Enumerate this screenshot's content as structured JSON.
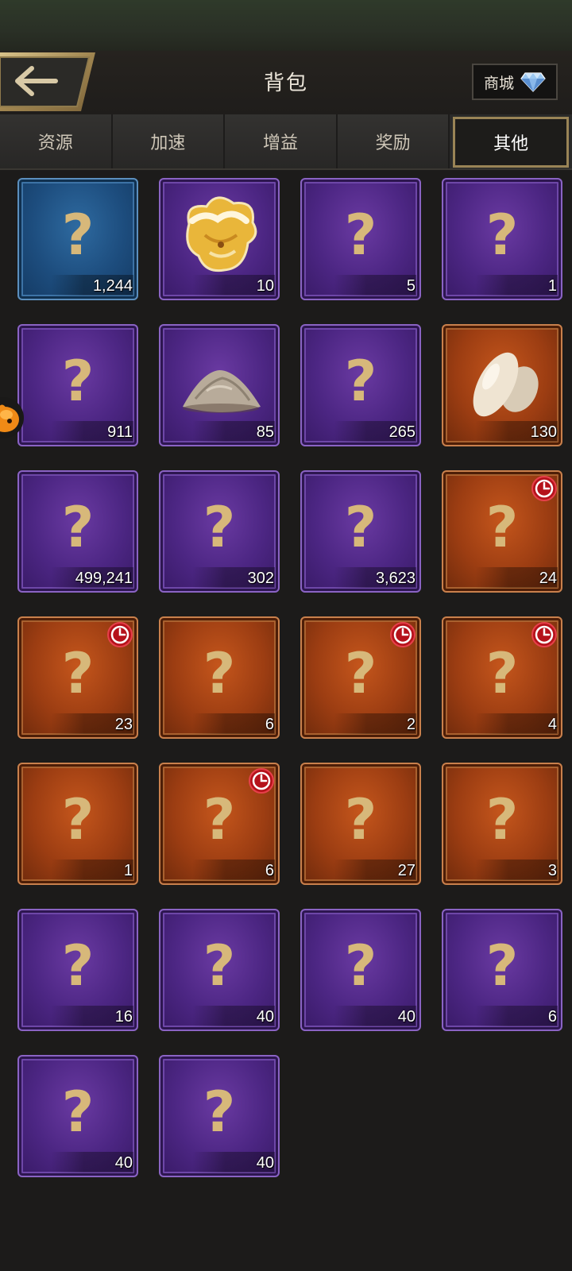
{
  "header": {
    "title": "背包",
    "shop_label": "商城"
  },
  "tabs": [
    {
      "label": "资源",
      "active": false
    },
    {
      "label": "加速",
      "active": false
    },
    {
      "label": "增益",
      "active": false
    },
    {
      "label": "奖励",
      "active": false
    },
    {
      "label": "其他",
      "active": true
    }
  ],
  "items": [
    {
      "count": "1,244",
      "rarity": "blue",
      "icon": "question-mark-icon",
      "timer": false
    },
    {
      "count": "10",
      "rarity": "purple",
      "icon": "mushroom-icon",
      "timer": false
    },
    {
      "count": "5",
      "rarity": "purple",
      "icon": "question-mark-icon",
      "timer": false
    },
    {
      "count": "1",
      "rarity": "purple",
      "icon": "question-mark-icon",
      "timer": false
    },
    {
      "count": "911",
      "rarity": "purple",
      "icon": "question-mark-icon",
      "timer": false
    },
    {
      "count": "85",
      "rarity": "purple",
      "icon": "powder-pile-icon",
      "timer": false
    },
    {
      "count": "265",
      "rarity": "purple",
      "icon": "question-mark-icon",
      "timer": false
    },
    {
      "count": "130",
      "rarity": "orange",
      "icon": "stones-icon",
      "timer": false
    },
    {
      "count": "499,241",
      "rarity": "purple",
      "icon": "question-mark-icon",
      "timer": false
    },
    {
      "count": "302",
      "rarity": "purple",
      "icon": "question-mark-icon",
      "timer": false
    },
    {
      "count": "3,623",
      "rarity": "purple",
      "icon": "question-mark-icon",
      "timer": false
    },
    {
      "count": "24",
      "rarity": "orange",
      "icon": "question-mark-icon",
      "timer": true
    },
    {
      "count": "23",
      "rarity": "orange",
      "icon": "question-mark-icon",
      "timer": true
    },
    {
      "count": "6",
      "rarity": "orange",
      "icon": "question-mark-icon",
      "timer": false
    },
    {
      "count": "2",
      "rarity": "orange",
      "icon": "question-mark-icon",
      "timer": true
    },
    {
      "count": "4",
      "rarity": "orange",
      "icon": "question-mark-icon",
      "timer": true
    },
    {
      "count": "1",
      "rarity": "orange",
      "icon": "question-mark-icon",
      "timer": false
    },
    {
      "count": "6",
      "rarity": "orange",
      "icon": "question-mark-icon",
      "timer": true
    },
    {
      "count": "27",
      "rarity": "orange",
      "icon": "question-mark-icon",
      "timer": false
    },
    {
      "count": "3",
      "rarity": "orange",
      "icon": "question-mark-icon",
      "timer": false
    },
    {
      "count": "16",
      "rarity": "purple",
      "icon": "question-mark-icon",
      "timer": false
    },
    {
      "count": "40",
      "rarity": "purple",
      "icon": "question-mark-icon",
      "timer": false
    },
    {
      "count": "40",
      "rarity": "purple",
      "icon": "question-mark-icon",
      "timer": false
    },
    {
      "count": "6",
      "rarity": "purple",
      "icon": "question-mark-icon",
      "timer": false
    },
    {
      "count": "40",
      "rarity": "purple",
      "icon": "question-mark-icon",
      "timer": false
    },
    {
      "count": "40",
      "rarity": "purple",
      "icon": "question-mark-icon",
      "timer": false
    }
  ],
  "colors": {
    "accent_gold": "#9a8456",
    "rarity_blue": "#1d4d7e",
    "rarity_purple": "#4c2683",
    "rarity_orange": "#9c3d12",
    "timer_red": "#c0141c"
  }
}
